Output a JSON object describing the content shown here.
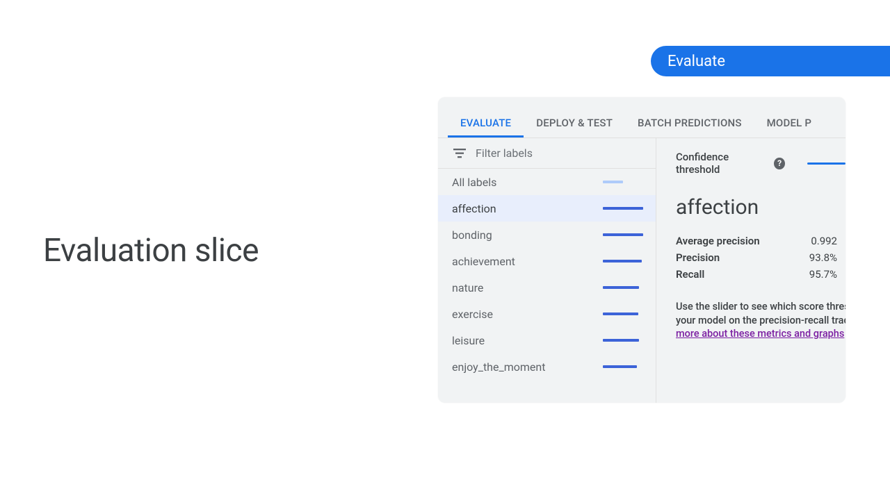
{
  "badge": {
    "label": "Evaluate"
  },
  "slide_title": "Evaluation slice",
  "tabs": [
    {
      "label": "EVALUATE",
      "active": true
    },
    {
      "label": "DEPLOY & TEST",
      "active": false
    },
    {
      "label": "BATCH PREDICTIONS",
      "active": false
    },
    {
      "label": "MODEL P",
      "active": false
    }
  ],
  "filter": {
    "placeholder": "Filter labels"
  },
  "labels": [
    {
      "name": "All labels",
      "bar": 50,
      "all": true,
      "selected": false
    },
    {
      "name": "affection",
      "bar": 100,
      "all": false,
      "selected": true
    },
    {
      "name": "bonding",
      "bar": 100,
      "all": false,
      "selected": false
    },
    {
      "name": "achievement",
      "bar": 97,
      "all": false,
      "selected": false
    },
    {
      "name": "nature",
      "bar": 90,
      "all": false,
      "selected": false
    },
    {
      "name": "exercise",
      "bar": 88,
      "all": false,
      "selected": false
    },
    {
      "name": "leisure",
      "bar": 90,
      "all": false,
      "selected": false
    },
    {
      "name": "enjoy_the_moment",
      "bar": 85,
      "all": false,
      "selected": false
    }
  ],
  "threshold": {
    "label": "Confidence threshold"
  },
  "detail": {
    "title": "affection",
    "metrics": [
      {
        "label": "Average precision",
        "value": "0.992"
      },
      {
        "label": "Precision",
        "value": "93.8%"
      },
      {
        "label": "Recall",
        "value": "95.7%"
      }
    ],
    "desc_line1": "Use the slider to see which score thresh",
    "desc_line2": "your model on the precision-recall trade",
    "desc_link": "more about these metrics and graphs"
  }
}
